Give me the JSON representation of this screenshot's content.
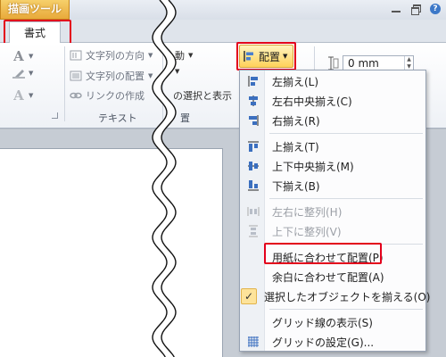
{
  "titlebar": {
    "context_tab": "描画ツール",
    "help_glyph": "?"
  },
  "ribbon": {
    "format_tab": "書式",
    "text_group": {
      "text_direction": "文字列の方向",
      "text_align": "文字列の配置",
      "create_link": "リンクの作成",
      "label": "テキスト"
    },
    "arrange_group": {
      "move_partial": "動",
      "selection_pane_partial": "の選択と表示",
      "label_partial": "置",
      "arrange_button": "配置"
    },
    "size_group": {
      "value": "0 mm"
    },
    "icons": {
      "font_letter": "A",
      "spin_up": "▲",
      "spin_down": "▼"
    }
  },
  "menu": {
    "items": [
      {
        "label": "左揃え(L)",
        "icon": "align-left-icon",
        "disabled": false
      },
      {
        "label": "左右中央揃え(C)",
        "icon": "align-center-icon",
        "disabled": false
      },
      {
        "label": "右揃え(R)",
        "icon": "align-right-icon",
        "disabled": false
      },
      {
        "label": "上揃え(T)",
        "icon": "align-top-icon",
        "disabled": false
      },
      {
        "label": "上下中央揃え(M)",
        "icon": "align-middle-icon",
        "disabled": false
      },
      {
        "label": "下揃え(B)",
        "icon": "align-bottom-icon",
        "disabled": false
      },
      {
        "label": "左右に整列(H)",
        "icon": "distribute-horizontal-icon",
        "disabled": true
      },
      {
        "label": "上下に整列(V)",
        "icon": "distribute-vertical-icon",
        "disabled": true
      },
      {
        "label": "用紙に合わせて配置(P)",
        "icon": "",
        "disabled": false
      },
      {
        "label": "余白に合わせて配置(A)",
        "icon": "",
        "disabled": false
      },
      {
        "label": "選択したオブジェクトを揃える(O)",
        "icon": "checkmark-icon",
        "disabled": false,
        "checked": true
      },
      {
        "label": "グリッド線の表示(S)",
        "icon": "",
        "disabled": false
      },
      {
        "label": "グリッドの設定(G)...",
        "icon": "grid-icon",
        "disabled": false
      }
    ],
    "check_glyph": "✓"
  },
  "colors": {
    "highlight": "#e3001b",
    "context_tab": "#e8a93a",
    "arrange_button": "#ffd25a"
  }
}
